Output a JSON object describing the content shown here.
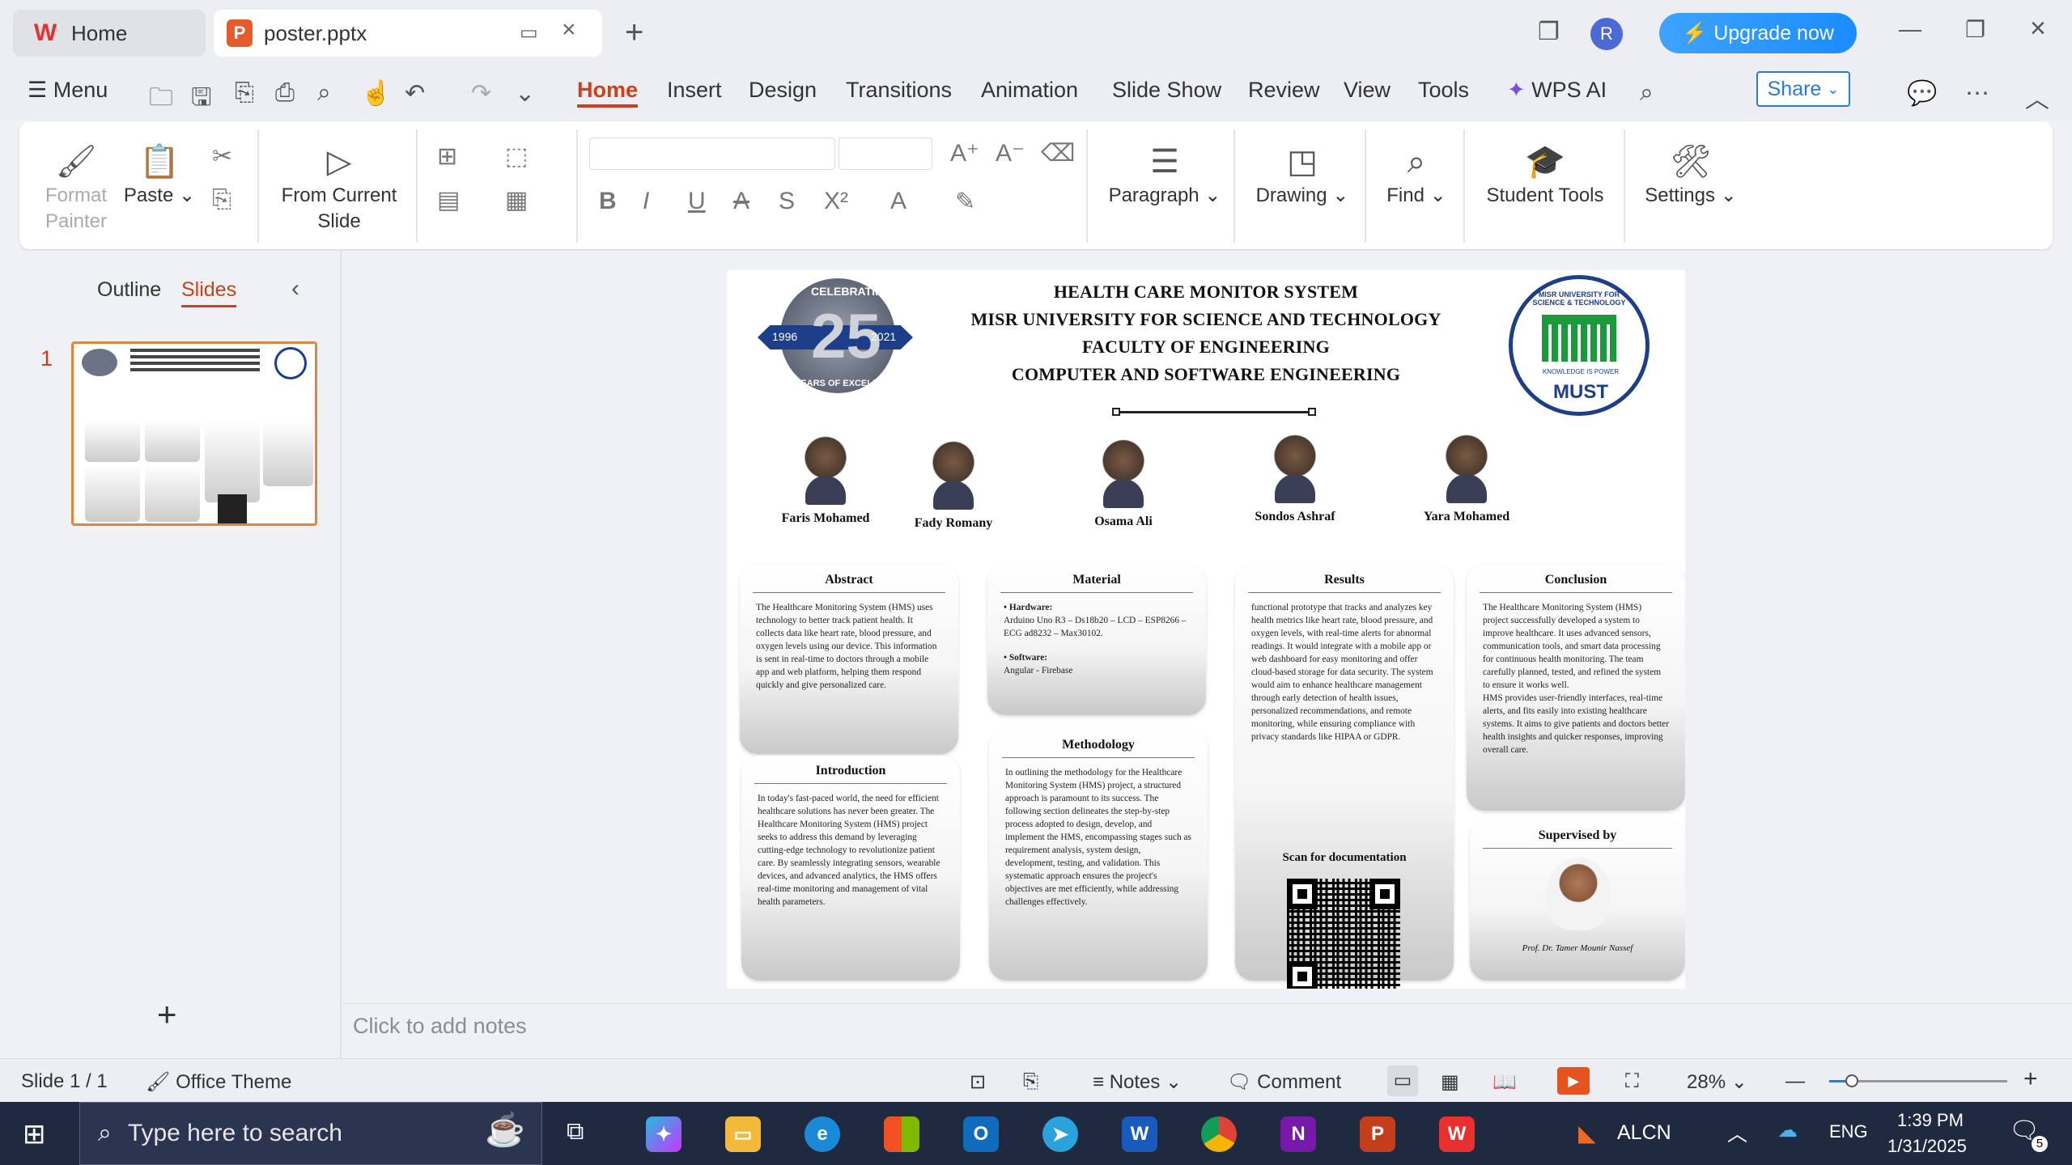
{
  "titlebar": {
    "home_tab": "Home",
    "doc_tab": "poster.pptx",
    "upgrade": "Upgrade now",
    "avatar_initial": "R"
  },
  "menubar": {
    "menu": "Menu",
    "tabs": [
      "Home",
      "Insert",
      "Design",
      "Transitions",
      "Animation",
      "Slide Show",
      "Review",
      "View",
      "Tools"
    ],
    "wps_ai": "WPS AI",
    "share": "Share"
  },
  "ribbon": {
    "format_painter": "Format Painter",
    "paste": "Paste",
    "from_current_slide": "From Current Slide",
    "paragraph": "Paragraph",
    "drawing": "Drawing",
    "find": "Find",
    "student_tools": "Student Tools",
    "settings": "Settings"
  },
  "leftpanel": {
    "outline": "Outline",
    "slides": "Slides",
    "slide_number": "1"
  },
  "notes": {
    "placeholder": "Click to add notes"
  },
  "slide": {
    "headers": [
      "HEALTH CARE MONITOR SYSTEM",
      "MISR UNIVERSITY FOR SCIENCE AND TECHNOLOGY",
      "FACULTY OF ENGINEERING",
      "COMPUTER AND SOFTWARE ENGINEERING"
    ],
    "logo_left": {
      "top": "CELEBRATING",
      "number": "25",
      "year_start": "1996",
      "year_end": "2021",
      "bottom": "YEARS OF EXCELLENCE"
    },
    "logo_right": {
      "ring": "MISR UNIVERSITY FOR SCIENCE & TECHNOLOGY",
      "motto": "KNOWLEDGE IS POWER",
      "abbr": "MUST"
    },
    "members": [
      "Faris Mohamed",
      "Fady Romany",
      "Osama Ali",
      "Sondos Ashraf",
      "Yara Mohamed"
    ],
    "abstract": {
      "title": "Abstract",
      "body": "The Healthcare Monitoring System (HMS) uses technology to better track patient health. It collects data like heart rate, blood pressure, and oxygen levels using our device. This information is sent in real-time to doctors through a mobile app and web platform, helping them respond quickly and give personalized care."
    },
    "introduction": {
      "title": "Introduction",
      "body": "In today's fast-paced world, the need for efficient healthcare solutions has never been greater. The Healthcare Monitoring System (HMS) project seeks to address this demand by leveraging cutting-edge technology to revolutionize patient care. By seamlessly integrating sensors, wearable devices, and advanced analytics, the HMS offers real-time monitoring and management of vital health parameters."
    },
    "material": {
      "title": "Material",
      "hardware_label": "• Hardware:",
      "hardware": "Arduino Uno R3 – Ds18b20 – LCD – ESP8266 – ECG ad8232 – Max30102.",
      "software_label": "• Software:",
      "software": "Angular - Firebase"
    },
    "methodology": {
      "title": "Methodology",
      "body": "In outlining the methodology for the Healthcare Monitoring System (HMS) project, a structured approach is paramount to its success. The following section delineates the step-by-step process adopted to design, develop, and implement the HMS, encompassing stages such as requirement analysis, system design, development, testing, and validation. This systematic approach ensures the project's objectives are met efficiently, while addressing challenges effectively."
    },
    "results": {
      "title": "Results",
      "body": "functional prototype that tracks and analyzes key health metrics like heart rate, blood pressure, and oxygen levels, with real-time alerts for abnormal readings. It would integrate with a mobile app or web dashboard for easy monitoring and offer cloud-based storage for data security. The system would aim to enhance healthcare management through early detection of health issues, personalized recommendations, and remote monitoring, while ensuring compliance with privacy standards like HIPAA or GDPR.",
      "scan": "Scan for documentation"
    },
    "conclusion": {
      "title": "Conclusion",
      "body": "The Healthcare Monitoring System (HMS) project successfully developed a system to improve healthcare. It uses advanced sensors, communication tools, and smart data processing for continuous health monitoring. The team carefully planned, tested, and refined the system to ensure it works well.\nHMS provides user-friendly interfaces, real-time alerts, and fits easily into existing healthcare systems. It aims to give patients and doctors better health insights and quicker responses, improving overall care."
    },
    "supervisor": {
      "title": "Supervised by",
      "name": "Prof. Dr. Tamer Mounir Nassef"
    }
  },
  "statusbar": {
    "slide": "Slide 1 / 1",
    "theme": "Office Theme",
    "notes": "Notes",
    "comment": "Comment",
    "zoom": "28%"
  },
  "taskbar": {
    "search_placeholder": "Type here to search",
    "keyboard": "ALCN",
    "lang": "ENG",
    "time": "1:39 PM",
    "date": "1/31/2025",
    "notif": "5"
  }
}
